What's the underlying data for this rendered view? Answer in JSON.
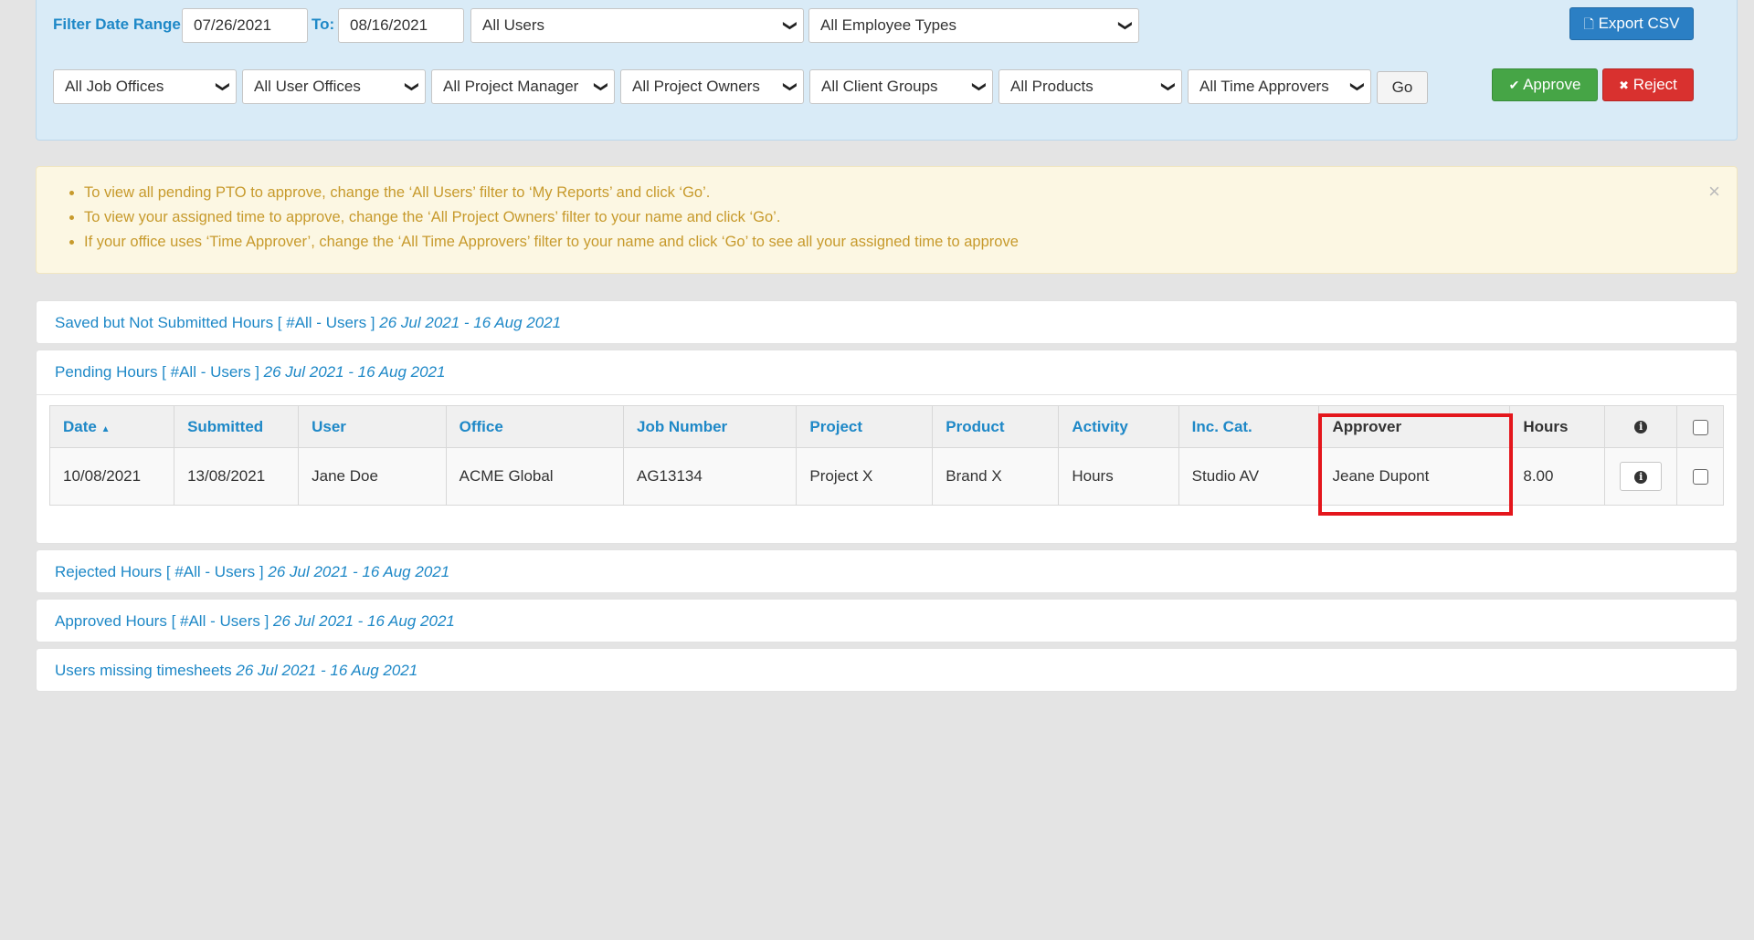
{
  "filters": {
    "date_range_label": "Filter Date Range",
    "date_from": "07/26/2021",
    "to_label": "To:",
    "date_to": "08/16/2021",
    "users": "All Users",
    "employee_types": "All Employee Types",
    "job_offices": "All Job Offices",
    "user_offices": "All User Offices",
    "project_manager": "All Project Manager",
    "project_owners": "All Project Owners",
    "client_groups": "All Client Groups",
    "products": "All Products",
    "time_approvers": "All Time Approvers",
    "go_label": "Go"
  },
  "actions": {
    "export_label": "Export CSV",
    "approve_label": "Approve",
    "reject_label": "Reject"
  },
  "alert": {
    "items": [
      "To view all pending PTO to approve, change the ‘All Users’ filter to ‘My Reports’ and click ‘Go’.",
      "To view your assigned time to approve, change the ‘All Project Owners’ filter to your name and click ‘Go’.",
      "If your office uses ‘Time Approver’, change the ‘All Time Approvers’ filter to your name and click ‘Go’ to see all your assigned time to approve"
    ],
    "close": "×"
  },
  "sections": {
    "saved": {
      "title": "Saved but Not Submitted Hours [ #All - Users ]",
      "range": "26 Jul 2021 - 16 Aug 2021"
    },
    "pending": {
      "title": "Pending Hours [ #All - Users ]",
      "range": "26 Jul 2021 - 16 Aug 2021"
    },
    "rejected": {
      "title": "Rejected Hours [ #All - Users ]",
      "range": "26 Jul 2021 - 16 Aug 2021"
    },
    "approved": {
      "title": "Approved Hours [ #All - Users ]",
      "range": "26 Jul 2021 - 16 Aug 2021"
    },
    "missing": {
      "title": "Users missing timesheets",
      "range": "26 Jul 2021 - 16 Aug 2021"
    }
  },
  "table": {
    "headers": [
      "Date",
      "Submitted",
      "User",
      "Office",
      "Job Number",
      "Project",
      "Product",
      "Activity",
      "Inc. Cat.",
      "Approver",
      "Hours"
    ],
    "sort_indicator": "▲",
    "rows": [
      [
        "10/08/2021",
        "13/08/2021",
        "Jane Doe",
        "ACME Global",
        "AG13134",
        "Project X",
        "Brand X",
        "Hours",
        "Studio AV",
        "Jeane Dupont",
        "8.00"
      ]
    ]
  },
  "icons": {
    "chevron": "❯",
    "file": "🗋",
    "check": "✔",
    "cross": "✖",
    "info": "i"
  },
  "colors": {
    "link": "#1e88c7",
    "approve": "#46a546",
    "reject": "#d9312f",
    "export": "#2b7fc4",
    "highlight": "#e4161c"
  }
}
